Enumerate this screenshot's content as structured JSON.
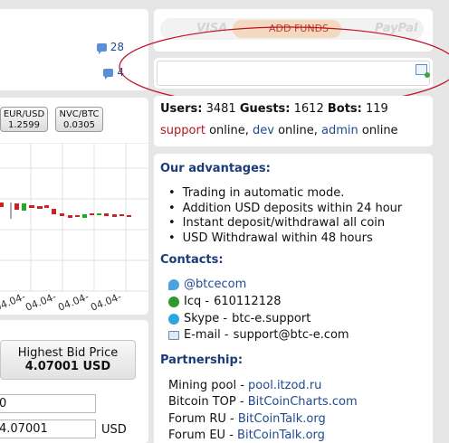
{
  "forum": {
    "count1": "28",
    "count2": "4"
  },
  "tickers": [
    {
      "pair": "EUR/USD",
      "price": "1.2599"
    },
    {
      "pair": "NVC/BTC",
      "price": "0.0305"
    }
  ],
  "chart": {
    "x_labels": [
      "04.04-",
      "04.04-",
      "04.04-",
      "04.04-"
    ]
  },
  "trade": {
    "bid_title": "Highest Bid Price",
    "bid_value": "4.07001 USD",
    "amount_value": "0",
    "price_value": "4.07001",
    "currency": "USD"
  },
  "funds": {
    "visa": "VISA",
    "add_label": "ADD FUNDS",
    "paypal": "PayPal"
  },
  "online": {
    "users_label": "Users:",
    "users": "3481",
    "guests_label": "Guests:",
    "guests": "1612",
    "bots_label": "Bots:",
    "bots": "119",
    "staff": [
      {
        "name": "support",
        "status": "online,"
      },
      {
        "name": "dev",
        "status": "online,"
      },
      {
        "name": "admin",
        "status": "online"
      }
    ]
  },
  "info": {
    "advantages_title": "Our advantages:",
    "advantages": [
      "Trading in automatic mode.",
      "Addition USD deposits within 24 hour",
      "Instant deposit/withdrawal all coin",
      "USD Withdrawal within 48 hours"
    ],
    "contacts_title": "Contacts:",
    "twitter": "@btcecom",
    "icq_label": "Icq -",
    "icq": "610112128",
    "skype_label": "Skype -",
    "skype": "btc-e.support",
    "email_label": "E-mail -",
    "email": "support@btc-e.com",
    "partnership_title": "Partnership:",
    "partners": [
      {
        "label": "Mining pool -",
        "link": "pool.itzod.ru"
      },
      {
        "label": "Bitcoin TOP -",
        "link": "BitCoinCharts.com"
      },
      {
        "label": "Forum RU -",
        "link": "BitCoinTalk.org"
      },
      {
        "label": "Forum EU -",
        "link": "BitCoinTalk.org"
      }
    ]
  },
  "colors": {
    "background": "#e6e6e6",
    "link": "#1f4a8f",
    "heading": "#1a3c78",
    "support": "#b3171d",
    "ellipse": "#c0102a"
  }
}
